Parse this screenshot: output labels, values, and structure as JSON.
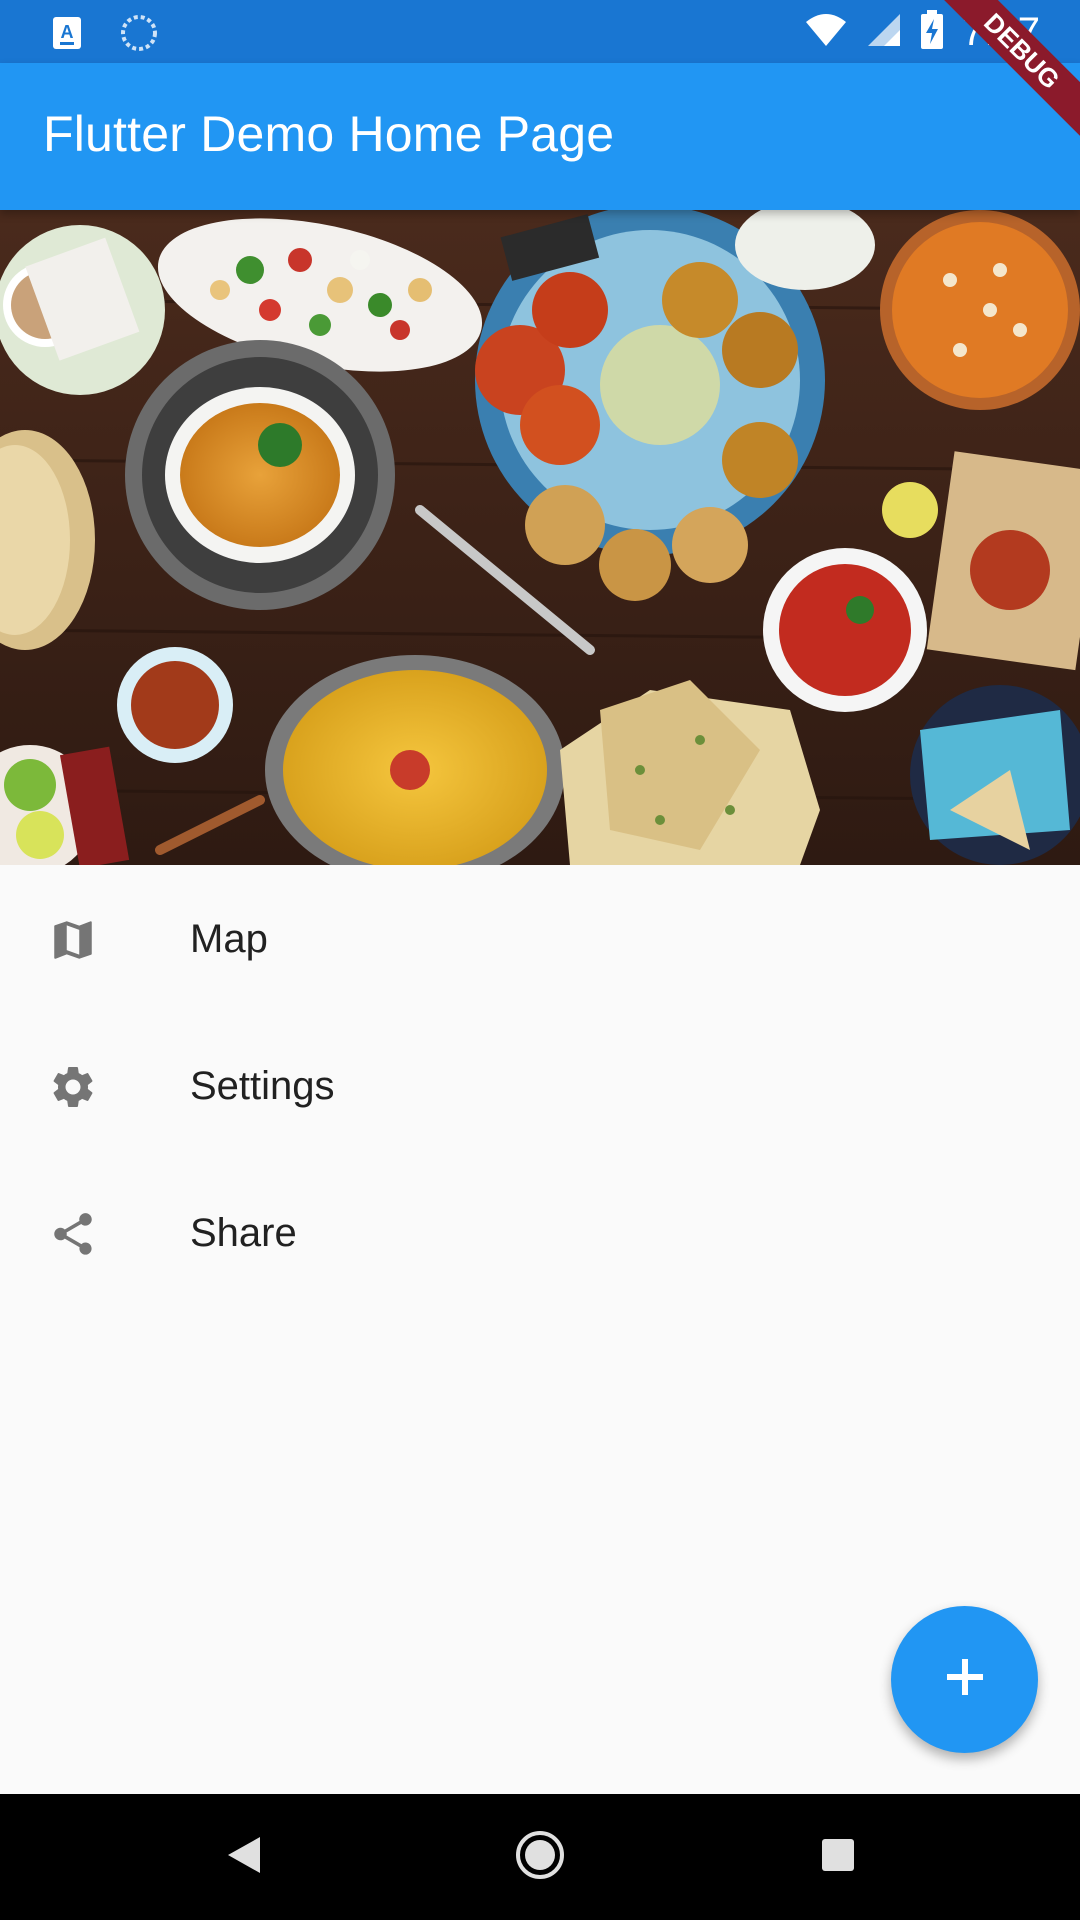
{
  "status_bar": {
    "time": "7:27",
    "icons": [
      "app-notification-icon",
      "sync-icon",
      "wifi-icon",
      "cell-signal-icon",
      "battery-charging-icon"
    ],
    "color": "#1976d2"
  },
  "app_bar": {
    "title": "Flutter Demo Home Page",
    "color": "#2196f3"
  },
  "debug_banner": "DEBUG",
  "hero": {
    "description_icon": "food-spread-image"
  },
  "menu": {
    "items": [
      {
        "label": "Map",
        "icon": "map-icon"
      },
      {
        "label": "Settings",
        "icon": "settings-icon"
      },
      {
        "label": "Share",
        "icon": "share-icon"
      }
    ],
    "icon_color": "#757575"
  },
  "fab": {
    "icon": "add-icon",
    "color": "#2196f3"
  },
  "nav_bar": {
    "icons": [
      "back-icon",
      "home-icon",
      "recents-icon"
    ]
  }
}
